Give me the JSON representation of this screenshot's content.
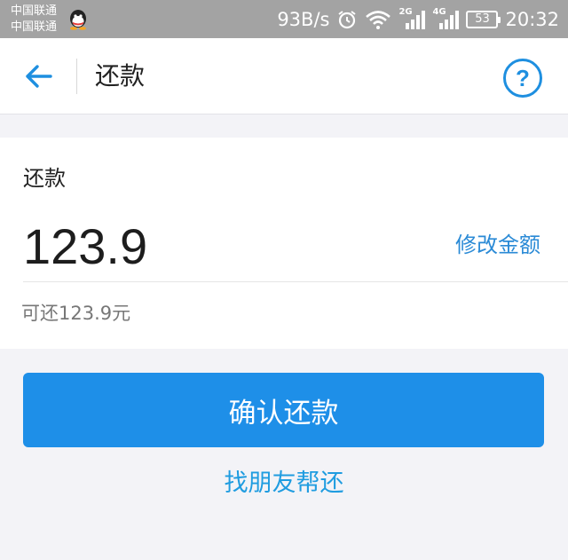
{
  "status_bar": {
    "carrier_1": "中国联通",
    "carrier_2": "中国联通",
    "net_speed": "93B/s",
    "signal_1_tag": "2G",
    "signal_2_tag": "4G",
    "battery": "53",
    "time": "20:32",
    "icons": [
      "qq-icon",
      "alarm-icon",
      "wifi-icon",
      "signal-icon",
      "signal-icon",
      "battery-icon"
    ]
  },
  "header": {
    "title": "还款",
    "help_symbol": "?",
    "accent_color": "#1e8fe0"
  },
  "repay_card": {
    "label": "还款",
    "amount": "123.9",
    "edit_link": "修改金额",
    "hint": "可还123.9元"
  },
  "actions": {
    "confirm_label": "确认还款",
    "friend_label": "找朋友帮还",
    "button_color": "#1e8fe8"
  }
}
